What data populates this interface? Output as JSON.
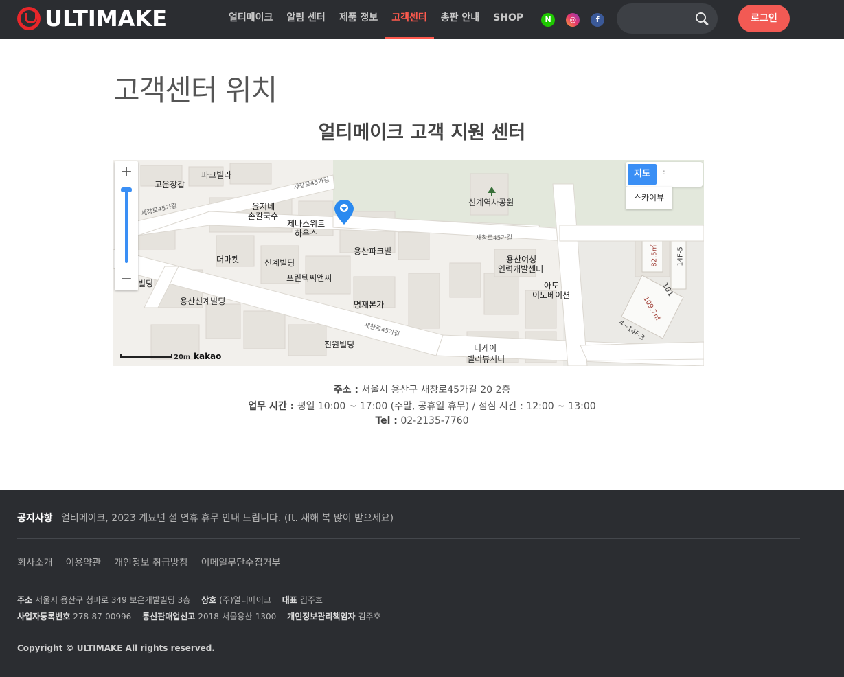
{
  "header": {
    "logo_text": "ULTIMAKE",
    "nav": [
      {
        "label": "얼티메이크",
        "active": false
      },
      {
        "label": "알림 센터",
        "active": false
      },
      {
        "label": "제품 정보",
        "active": false
      },
      {
        "label": "고객센터",
        "active": true
      },
      {
        "label": "총판 안내",
        "active": false
      },
      {
        "label": "SHOP",
        "active": false
      }
    ],
    "social": [
      {
        "icon": "naver-icon",
        "glyph": "N"
      },
      {
        "icon": "instagram-icon",
        "glyph": "◎"
      },
      {
        "icon": "facebook-icon",
        "glyph": "f"
      }
    ],
    "search_placeholder": "",
    "login_label": "로그인"
  },
  "main": {
    "page_title": "고객센터 위치",
    "center_title": "얼티메이크 고객 지원 센터",
    "map": {
      "zoom_in": "+",
      "zoom_out": "−",
      "type_map": "지도",
      "type_sep": ":",
      "type_skyview": "스카이뷰",
      "scale_label": "20m",
      "provider": "kakao",
      "labels": {
        "l1": "파크빌라",
        "l2": "고운장갑",
        "l3": "윤지네",
        "l4": "손칼국수",
        "l5": "제나스위트",
        "l6": "하우스",
        "l7": "용산파크빌",
        "l8": "더마켓",
        "l9": "신계빌딩",
        "l10": "프린텍씨앤씨",
        "l11": "명재본가",
        "l12": "용산신계빌딩",
        "l13": "진원빌딩",
        "l14": "디케이",
        "l15": "벨리뷰시티",
        "l16": "신계역사공원",
        "l17": "용산여성",
        "l18": "인력개발센터",
        "l19": "아토",
        "l20": "이노베이션",
        "l21": "새창로45가길",
        "l22": "새창로45가길",
        "l23": "새창로45가길",
        "l24": "새창로45가길",
        "l25": "빌딩",
        "l26": "82.5㎡",
        "l27": "109.7㎡",
        "l28": "101",
        "l29": "14F-5",
        "l30": "4~14F-3"
      }
    },
    "address_label": "주소 :",
    "address": "서울시 용산구 새창로45가길 20 2층",
    "hours_label": "업무 시간 :",
    "hours": "평일 10:00 ~ 17:00 (주말, 공휴일 휴무) / 점심 시간 : 12:00 ~ 13:00",
    "tel_label": "Tel :",
    "tel": "02-2135-7760"
  },
  "footer": {
    "notice_label": "공지사항",
    "notice_text": "얼티메이크, 2023 계묘년 설 연휴 휴무 안내 드립니다. (ft. 새해 복 많이 받으세요)",
    "links": [
      "회사소개",
      "이용약관",
      "개인정보 취급방침",
      "이메일무단수집거부"
    ],
    "biz": {
      "address_label": "주소",
      "address": "서울시 용산구 청파로 349 보은개발빌딩 3층",
      "company_label": "상호",
      "company": "(주)얼티메이크",
      "ceo_label": "대표",
      "ceo": "김주호",
      "reg_label": "사업자등록번호",
      "reg": "278-87-00996",
      "mail_order_label": "통신판매업신고",
      "mail_order": "2018-서울용산-1300",
      "privacy_label": "개인정보관리책임자",
      "privacy": "김주호"
    },
    "copyright": "Copyright © ULTIMAKE All rights reserved."
  }
}
